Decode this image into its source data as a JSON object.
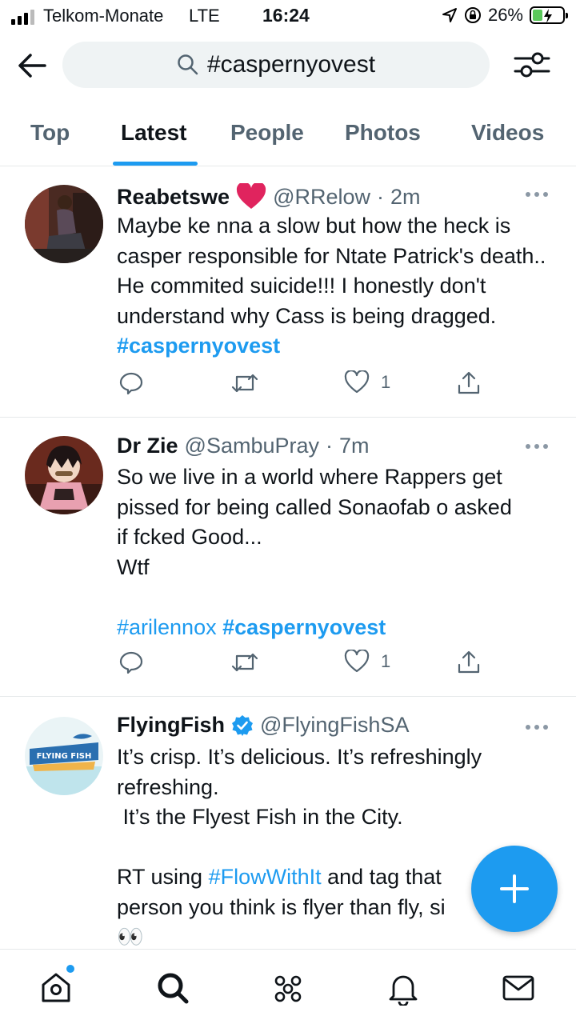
{
  "status_bar": {
    "carrier": "Telkom-Monate",
    "network": "LTE",
    "time": "16:24",
    "battery": "26%"
  },
  "search": {
    "query": "#caspernyovest"
  },
  "tabs": [
    {
      "label": "Top"
    },
    {
      "label": "Latest"
    },
    {
      "label": "People"
    },
    {
      "label": "Photos"
    },
    {
      "label": "Videos"
    }
  ],
  "tweets": [
    {
      "name": "Reabetswe",
      "handle": "@RRelow",
      "time": "2m",
      "text": "Maybe ke nna a slow but how the heck is casper responsible for Ntate Patrick's death.. He commited suicide!!! I honestly don't understand why Cass is being dragged.",
      "hashtag": "#caspernyovest",
      "likes": "1"
    },
    {
      "name": "Dr Zie",
      "handle": "@SambuPray",
      "time": "7m",
      "text_l1": "So we live in a world where Rappers get",
      "text_l2": "pissed for being called Sonaofab o asked",
      "text_l3": "if fcked Good...",
      "text_l4": "Wtf",
      "hashtag1": "#arilennox",
      "hashtag2": "#caspernyovest",
      "likes": "1"
    },
    {
      "name": "FlyingFish",
      "handle": "@FlyingFishSA",
      "text_l1": "It’s crisp. It’s delicious. It’s refreshingly",
      "text_l2": "refreshing.",
      "text_l3": " It’s the Flyest Fish in the City.",
      "text_l4a": "RT using ",
      "hashtag": "#FlowWithIt",
      "text_l4b": " and tag that",
      "text_l5": "person you think is flyer than fly, si",
      "emoji": "👀",
      "avatar_text": "FLYING FISH"
    }
  ],
  "colors": {
    "accent": "#1d9bf0",
    "secondary_text": "#536471",
    "heart_emoji": "#e0245e"
  }
}
